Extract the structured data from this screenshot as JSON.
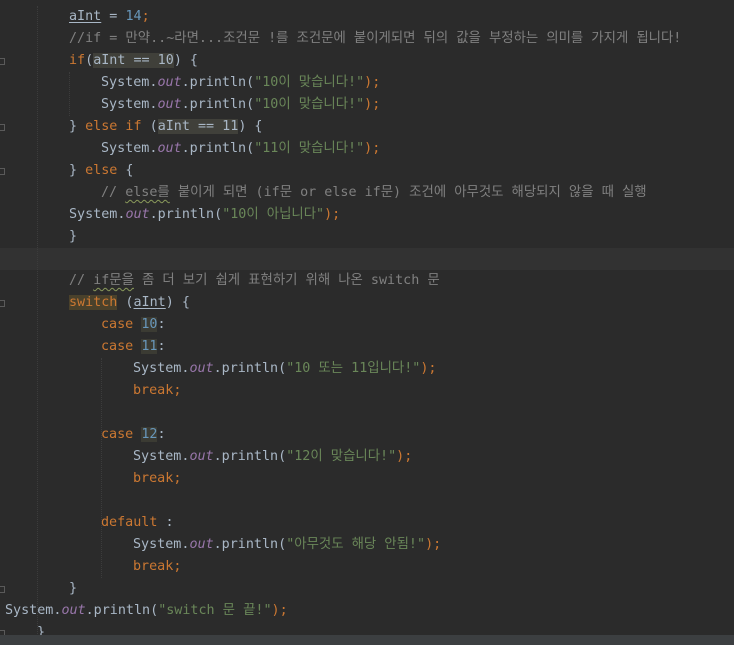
{
  "editor": {
    "lines": [
      {
        "parts": [
          [
            "aInt",
            "var-ul"
          ],
          [
            " = ",
            ""
          ],
          [
            "14",
            "num"
          ],
          [
            ";",
            "kw"
          ]
        ],
        "indent": 69
      },
      {
        "parts": [
          [
            "//if = 만약..~라면...조건문 !를 조건문에 붙이게되면 뒤의 값을 부정하는 의미를 가지게 됩니다!",
            "cmt"
          ]
        ],
        "indent": 69
      },
      {
        "parts": [
          [
            "if",
            "kw"
          ],
          [
            "(",
            ""
          ],
          [
            "aInt == 10",
            "hl-read"
          ],
          [
            ") {",
            ""
          ]
        ],
        "indent": 69
      },
      {
        "parts": [
          [
            "System.",
            ""
          ],
          [
            "out",
            "field"
          ],
          [
            ".println(",
            ""
          ],
          [
            "\"10이 맞습니다!\"",
            "str"
          ],
          [
            ");",
            "kw"
          ]
        ],
        "indent": 101
      },
      {
        "parts": [
          [
            "System.",
            ""
          ],
          [
            "out",
            "field"
          ],
          [
            ".println(",
            ""
          ],
          [
            "\"10이 맞습니다!\"",
            "str"
          ],
          [
            ");",
            "kw"
          ]
        ],
        "indent": 101
      },
      {
        "parts": [
          [
            "} ",
            ""
          ],
          [
            "else if",
            "kw"
          ],
          [
            " (",
            ""
          ],
          [
            "aInt == 11",
            "hl-read"
          ],
          [
            ") {",
            ""
          ]
        ],
        "indent": 69
      },
      {
        "parts": [
          [
            "System.",
            ""
          ],
          [
            "out",
            "field"
          ],
          [
            ".println(",
            ""
          ],
          [
            "\"11이 맞습니다!\"",
            "str"
          ],
          [
            ");",
            "kw"
          ]
        ],
        "indent": 101
      },
      {
        "parts": [
          [
            "} ",
            ""
          ],
          [
            "else",
            "kw"
          ],
          [
            " {",
            ""
          ]
        ],
        "indent": 69
      },
      {
        "parts": [
          [
            "// ",
            "cmt"
          ],
          [
            "else를",
            "cmt squiggle"
          ],
          [
            " 붙이게 되면 (if문 or else if문) 조건에 아무것도 해당되지 않을 때 실행",
            "cmt"
          ]
        ],
        "indent": 101
      },
      {
        "parts": [
          [
            "System.",
            ""
          ],
          [
            "out",
            "field"
          ],
          [
            ".println(",
            ""
          ],
          [
            "\"10이 아닙니다\"",
            "str"
          ],
          [
            ");",
            "kw"
          ]
        ],
        "indent": 69
      },
      {
        "parts": [
          [
            "}",
            ""
          ]
        ],
        "indent": 69
      },
      {
        "parts": [],
        "indent": 69,
        "current": true
      },
      {
        "parts": [
          [
            "// ",
            "cmt"
          ],
          [
            "if문을",
            "cmt squiggle"
          ],
          [
            " 좀 더 보기 쉽게 표현하기 위해 나온 switch 문",
            "cmt"
          ]
        ],
        "indent": 69
      },
      {
        "parts": [
          [
            "switch",
            "kw switch-hl"
          ],
          [
            " (",
            ""
          ],
          [
            "aInt",
            "var-ul"
          ],
          [
            ") {",
            ""
          ]
        ],
        "indent": 69
      },
      {
        "parts": [
          [
            "case ",
            "kw"
          ],
          [
            "10",
            "num hl-num"
          ],
          [
            ":",
            ""
          ]
        ],
        "indent": 101
      },
      {
        "parts": [
          [
            "case ",
            "kw"
          ],
          [
            "11",
            "num hl-num"
          ],
          [
            ":",
            ""
          ]
        ],
        "indent": 101
      },
      {
        "parts": [
          [
            "System.",
            ""
          ],
          [
            "out",
            "field"
          ],
          [
            ".println(",
            ""
          ],
          [
            "\"10 또는 11입니다!\"",
            "str"
          ],
          [
            ");",
            "kw"
          ]
        ],
        "indent": 133
      },
      {
        "parts": [
          [
            "break",
            "kw"
          ],
          [
            ";",
            "kw"
          ]
        ],
        "indent": 133
      },
      {
        "parts": [],
        "indent": 69
      },
      {
        "parts": [
          [
            "case ",
            "kw"
          ],
          [
            "12",
            "num hl-num"
          ],
          [
            ":",
            ""
          ]
        ],
        "indent": 101
      },
      {
        "parts": [
          [
            "System.",
            ""
          ],
          [
            "out",
            "field"
          ],
          [
            ".println(",
            ""
          ],
          [
            "\"12이 맞습니다!\"",
            "str"
          ],
          [
            ");",
            "kw"
          ]
        ],
        "indent": 133
      },
      {
        "parts": [
          [
            "break",
            "kw"
          ],
          [
            ";",
            "kw"
          ]
        ],
        "indent": 133
      },
      {
        "parts": [],
        "indent": 69
      },
      {
        "parts": [
          [
            "default",
            "kw"
          ],
          [
            " :",
            ""
          ]
        ],
        "indent": 101
      },
      {
        "parts": [
          [
            "System.",
            ""
          ],
          [
            "out",
            "field"
          ],
          [
            ".println(",
            ""
          ],
          [
            "\"아무것도 해당 안됨!\"",
            "str"
          ],
          [
            ");",
            "kw"
          ]
        ],
        "indent": 133
      },
      {
        "parts": [
          [
            "break",
            "kw"
          ],
          [
            ";",
            "kw"
          ]
        ],
        "indent": 133
      },
      {
        "parts": [
          [
            "}",
            ""
          ]
        ],
        "indent": 69
      },
      {
        "parts": [
          [
            "System.",
            ""
          ],
          [
            "out",
            "field"
          ],
          [
            ".println(",
            ""
          ],
          [
            "\"switch 문 끝!\"",
            "str"
          ],
          [
            ");",
            "kw"
          ]
        ],
        "indent": 5
      },
      {
        "parts": [
          [
            "}",
            ""
          ]
        ],
        "indent": 37
      }
    ]
  },
  "theme": {
    "background": "#2b2b2b",
    "keyword": "#cc7832",
    "string": "#6a8759",
    "number": "#6897bb",
    "comment": "#808080",
    "field": "#9876aa",
    "text": "#a9b7c6"
  }
}
